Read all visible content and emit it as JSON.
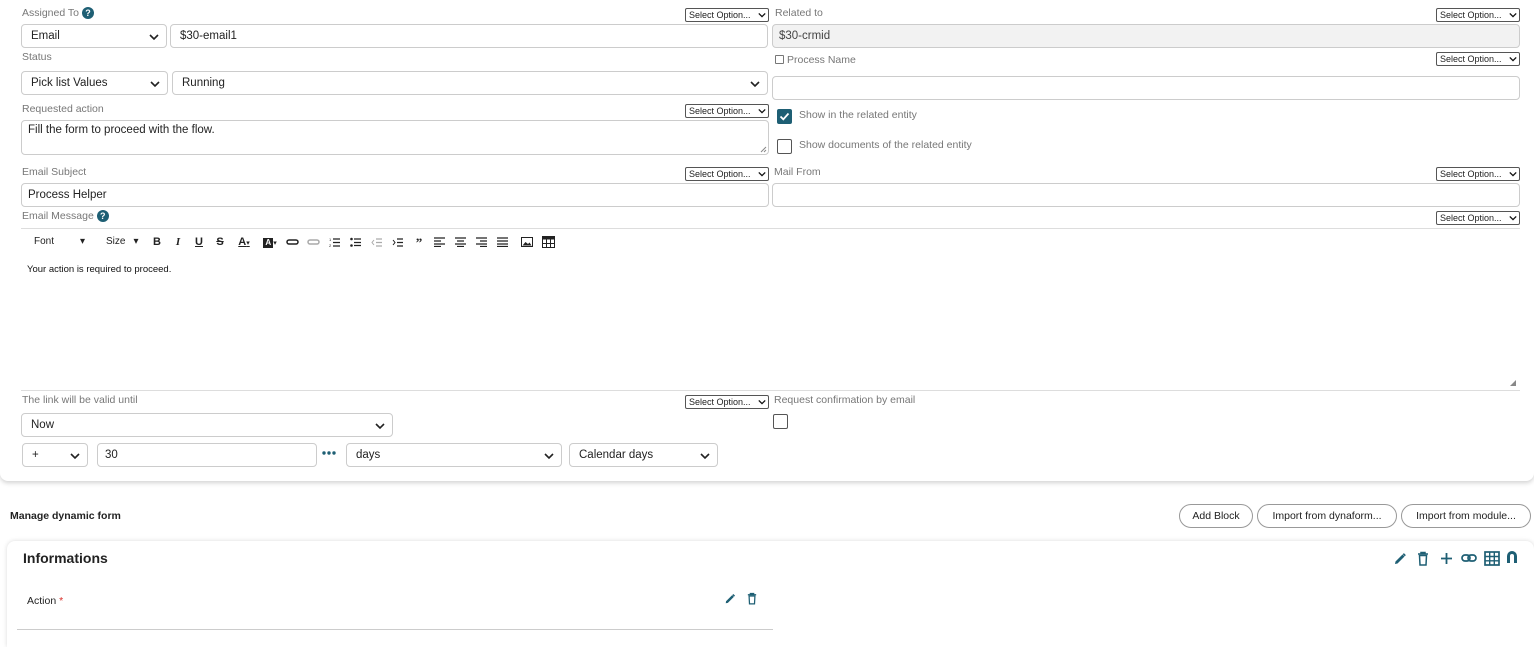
{
  "form": {
    "assigned_to": {
      "label": "Assigned To",
      "type_value": "Email",
      "value": "$30-email1"
    },
    "related_to": {
      "label": "Related to",
      "value": "$30-crmid"
    },
    "status": {
      "label": "Status",
      "type_value": "Pick list Values",
      "value": "Running"
    },
    "process_name": {
      "label": "Process Name",
      "value": ""
    },
    "requested_action": {
      "label": "Requested action",
      "value": "Fill the form to proceed with the flow."
    },
    "show_related_entity": {
      "label": "Show in the related entity",
      "checked": true
    },
    "show_documents": {
      "label": "Show documents of the related entity",
      "checked": false
    },
    "email_subject": {
      "label": "Email Subject",
      "value": "Process Helper"
    },
    "mail_from": {
      "label": "Mail From",
      "value": ""
    },
    "email_message": {
      "label": "Email Message",
      "body": "Your action is required to proceed."
    },
    "editor_toolbar": {
      "font": "Font",
      "size": "Size"
    },
    "link_valid": {
      "label": "The link will be valid until",
      "value": "Now",
      "operator": "+",
      "amount": "30",
      "unit": "days",
      "calendar": "Calendar days"
    },
    "request_confirmation": {
      "label": "Request confirmation by email",
      "checked": false
    },
    "select_option": "Select Option..."
  },
  "dynamic_form": {
    "title": "Manage dynamic form",
    "buttons": {
      "add_block": "Add Block",
      "import_dynaform": "Import from dynaform...",
      "import_module": "Import from module..."
    },
    "block": {
      "title": "Informations",
      "field_label": "Action",
      "required_mark": "*"
    }
  },
  "colors": {
    "accent": "#1e5f74"
  }
}
